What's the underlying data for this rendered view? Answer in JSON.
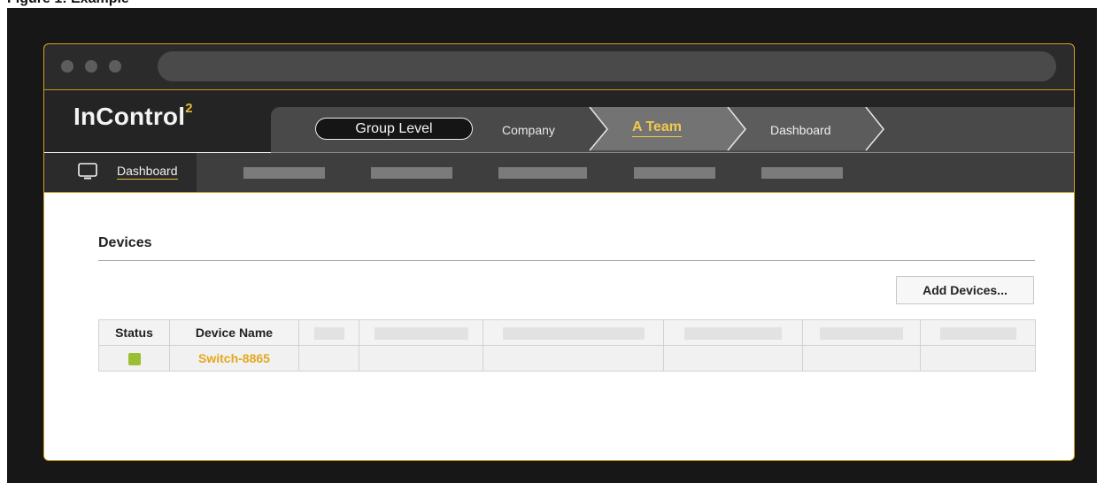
{
  "page_heading": "Figure 1: Example",
  "app": {
    "logo_text": "InControl",
    "logo_superscript": "2"
  },
  "breadcrumb": {
    "scope": "Group Level",
    "items": [
      "Company",
      "A Team",
      "Dashboard"
    ]
  },
  "nav": {
    "active_item": "Dashboard",
    "placeholder_item_count": 5
  },
  "devices": {
    "title": "Devices",
    "add_button": "Add Devices...",
    "columns": [
      "Status",
      "Device Name"
    ],
    "rows": [
      {
        "status": "online",
        "status_color": "#9bbf32",
        "device_name": "Switch-8865"
      }
    ]
  },
  "colors": {
    "accent_gold": "#d4a018",
    "link_gold": "#e3a81d",
    "status_online": "#9bbf32"
  },
  "icons": {
    "nav_dashboard": "monitor-icon"
  }
}
